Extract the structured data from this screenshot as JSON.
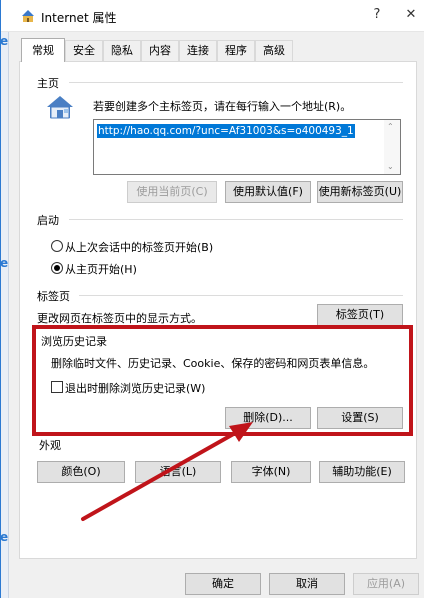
{
  "window": {
    "title": "Internet 属性",
    "help_button": "?",
    "close_button": "✕",
    "app_edge_letter": "e"
  },
  "tabs": [
    "常规",
    "安全",
    "隐私",
    "内容",
    "连接",
    "程序",
    "高级"
  ],
  "homepage": {
    "section": "主页",
    "description": "若要创建多个主标签页，请在每行输入一个地址(R)。",
    "url": "http://hao.qq.com/?unc=Af31003&s=o400493_1",
    "btn_current": "使用当前页(C)",
    "btn_default": "使用默认值(F)",
    "btn_newtab": "使用新标签页(U)"
  },
  "startup": {
    "section": "启动",
    "option_last_session": "从上次会话中的标签页开始(B)",
    "option_homepage": "从主页开始(H)",
    "selected": "option_homepage"
  },
  "tabs_section": {
    "section": "标签页",
    "description": "更改网页在标签页中的显示方式。",
    "btn_tabs": "标签页(T)"
  },
  "history": {
    "section": "浏览历史记录",
    "description": "删除临时文件、历史记录、Cookie、保存的密码和网页表单信息。",
    "checkbox_label": "退出时删除浏览历史记录(W)",
    "checkbox_checked": false,
    "btn_delete": "删除(D)...",
    "btn_settings": "设置(S)"
  },
  "appearance": {
    "section": "外观",
    "btn_colors": "颜色(O)",
    "btn_languages": "语言(L)",
    "btn_fonts": "字体(N)",
    "btn_accessibility": "辅助功能(E)"
  },
  "footer": {
    "btn_ok": "确定",
    "btn_cancel": "取消",
    "btn_apply": "应用(A)"
  },
  "colors": {
    "highlight_box": "#c0141a",
    "arrow": "#c0141a",
    "selection": "#0078d7"
  }
}
